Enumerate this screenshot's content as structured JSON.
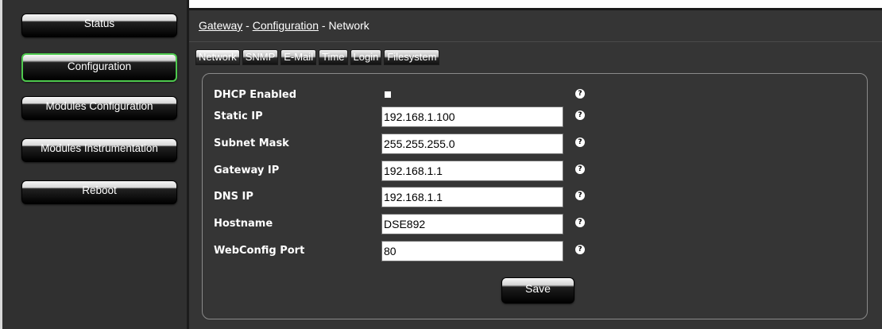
{
  "sidebar": {
    "items": [
      {
        "label": "Status",
        "active": false
      },
      {
        "label": "Configuration",
        "active": true
      },
      {
        "label": "Modules Configuration",
        "active": false
      },
      {
        "label": "Modules Instrumentation",
        "active": false
      },
      {
        "label": "Reboot",
        "active": false
      }
    ]
  },
  "breadcrumb": {
    "part1": "Gateway",
    "sep1": " - ",
    "part2": "Configuration",
    "sep2": " - ",
    "part3": "Network"
  },
  "tabs": [
    "Network",
    "SNMP",
    "E-Mail",
    "Time",
    "Login",
    "Filesystem"
  ],
  "active_tab": "Network",
  "form": {
    "dhcp": {
      "label": "DHCP Enabled",
      "checked": false
    },
    "static_ip": {
      "label": "Static IP",
      "value": "192.168.1.100"
    },
    "subnet_mask": {
      "label": "Subnet Mask",
      "value": "255.255.255.0"
    },
    "gateway_ip": {
      "label": "Gateway IP",
      "value": "192.168.1.1"
    },
    "dns_ip": {
      "label": "DNS IP",
      "value": "192.168.1.1"
    },
    "hostname": {
      "label": "Hostname",
      "value": "DSE892"
    },
    "webconfig_port": {
      "label": "WebConfig Port",
      "value": "80"
    },
    "help_glyph": "?",
    "save_label": "Save"
  },
  "colors": {
    "active_nav_border": "#4ec94e",
    "background": "#353535"
  }
}
